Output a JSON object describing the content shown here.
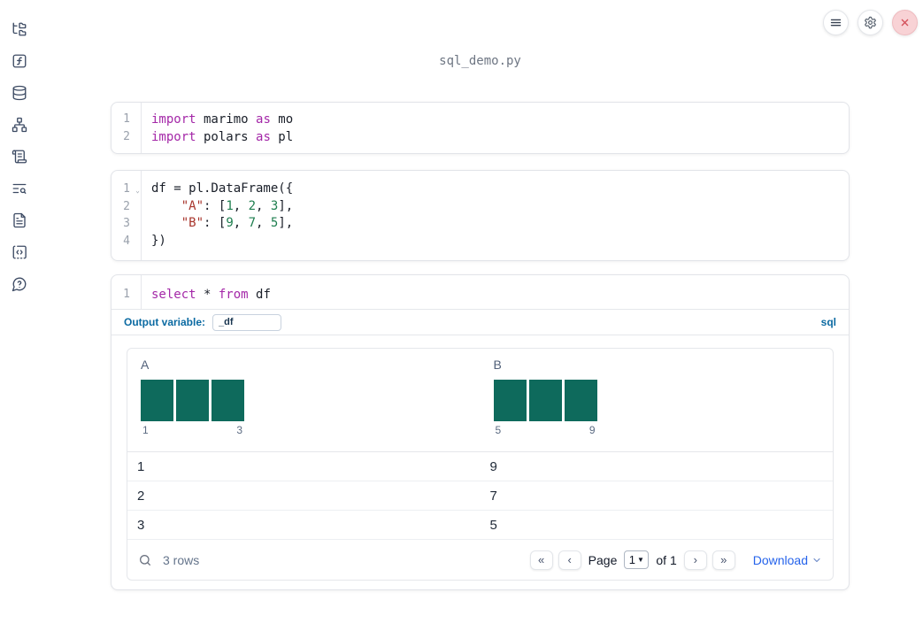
{
  "header": {
    "filename": "sql_demo.py"
  },
  "sidebar": {
    "icons": [
      "file-tree",
      "function",
      "database",
      "dependency-graph",
      "scratchpad-scroll",
      "table-of-contents-search",
      "documentation",
      "snippets-code",
      "help-question"
    ]
  },
  "topbar": {
    "icons": [
      "hamburger-menu",
      "settings-gear",
      "close-x"
    ]
  },
  "cells": {
    "imports": {
      "lines": [
        {
          "num": "1",
          "tokens": [
            {
              "t": "kw",
              "v": "import"
            },
            {
              "t": "plain",
              "v": " marimo "
            },
            {
              "t": "kw",
              "v": "as"
            },
            {
              "t": "plain",
              "v": " mo"
            }
          ]
        },
        {
          "num": "2",
          "tokens": [
            {
              "t": "kw",
              "v": "import"
            },
            {
              "t": "plain",
              "v": " polars "
            },
            {
              "t": "kw",
              "v": "as"
            },
            {
              "t": "plain",
              "v": " pl"
            }
          ]
        }
      ]
    },
    "dataframe": {
      "lines": [
        {
          "num": "1",
          "fold": true,
          "tokens": [
            {
              "t": "plain",
              "v": "df = pl.DataFrame({"
            }
          ]
        },
        {
          "num": "2",
          "tokens": [
            {
              "t": "plain",
              "v": "    "
            },
            {
              "t": "str",
              "v": "\"A\""
            },
            {
              "t": "plain",
              "v": ": ["
            },
            {
              "t": "num",
              "v": "1"
            },
            {
              "t": "plain",
              "v": ", "
            },
            {
              "t": "num",
              "v": "2"
            },
            {
              "t": "plain",
              "v": ", "
            },
            {
              "t": "num",
              "v": "3"
            },
            {
              "t": "plain",
              "v": "],"
            }
          ]
        },
        {
          "num": "3",
          "tokens": [
            {
              "t": "plain",
              "v": "    "
            },
            {
              "t": "str",
              "v": "\"B\""
            },
            {
              "t": "plain",
              "v": ": ["
            },
            {
              "t": "num",
              "v": "9"
            },
            {
              "t": "plain",
              "v": ", "
            },
            {
              "t": "num",
              "v": "7"
            },
            {
              "t": "plain",
              "v": ", "
            },
            {
              "t": "num",
              "v": "5"
            },
            {
              "t": "plain",
              "v": "],"
            }
          ]
        },
        {
          "num": "4",
          "tokens": [
            {
              "t": "plain",
              "v": "})"
            }
          ]
        }
      ]
    },
    "sql": {
      "lines": [
        {
          "num": "1",
          "tokens": [
            {
              "t": "kw",
              "v": "select"
            },
            {
              "t": "plain",
              "v": " * "
            },
            {
              "t": "kw",
              "v": "from"
            },
            {
              "t": "plain",
              "v": " df"
            }
          ]
        }
      ],
      "output_variable_label": "Output variable:",
      "output_variable_value": "_df",
      "language_badge": "sql"
    }
  },
  "table": {
    "columns": [
      {
        "name": "A",
        "hist_bar_count": 3,
        "hist_labels": [
          "1",
          "3"
        ]
      },
      {
        "name": "B",
        "hist_bar_count": 3,
        "hist_labels": [
          "5",
          "9"
        ]
      }
    ],
    "rows": [
      [
        "1",
        "9"
      ],
      [
        "2",
        "7"
      ],
      [
        "3",
        "5"
      ]
    ],
    "footer": {
      "row_count": "3 rows",
      "pagination": {
        "first": "«",
        "prev": "‹",
        "page_label": "Page",
        "page_value": "1",
        "of_label": "of 1",
        "next": "›",
        "last": "»"
      },
      "download_label": "Download"
    }
  },
  "colors": {
    "histogram_bar": "#0e6a5c",
    "label_blue": "#0b6aa2",
    "link_blue": "#2563eb",
    "keyword": "#a428a8",
    "string": "#a8352c",
    "number": "#1e7e4f",
    "close_red": "#d4505a"
  }
}
